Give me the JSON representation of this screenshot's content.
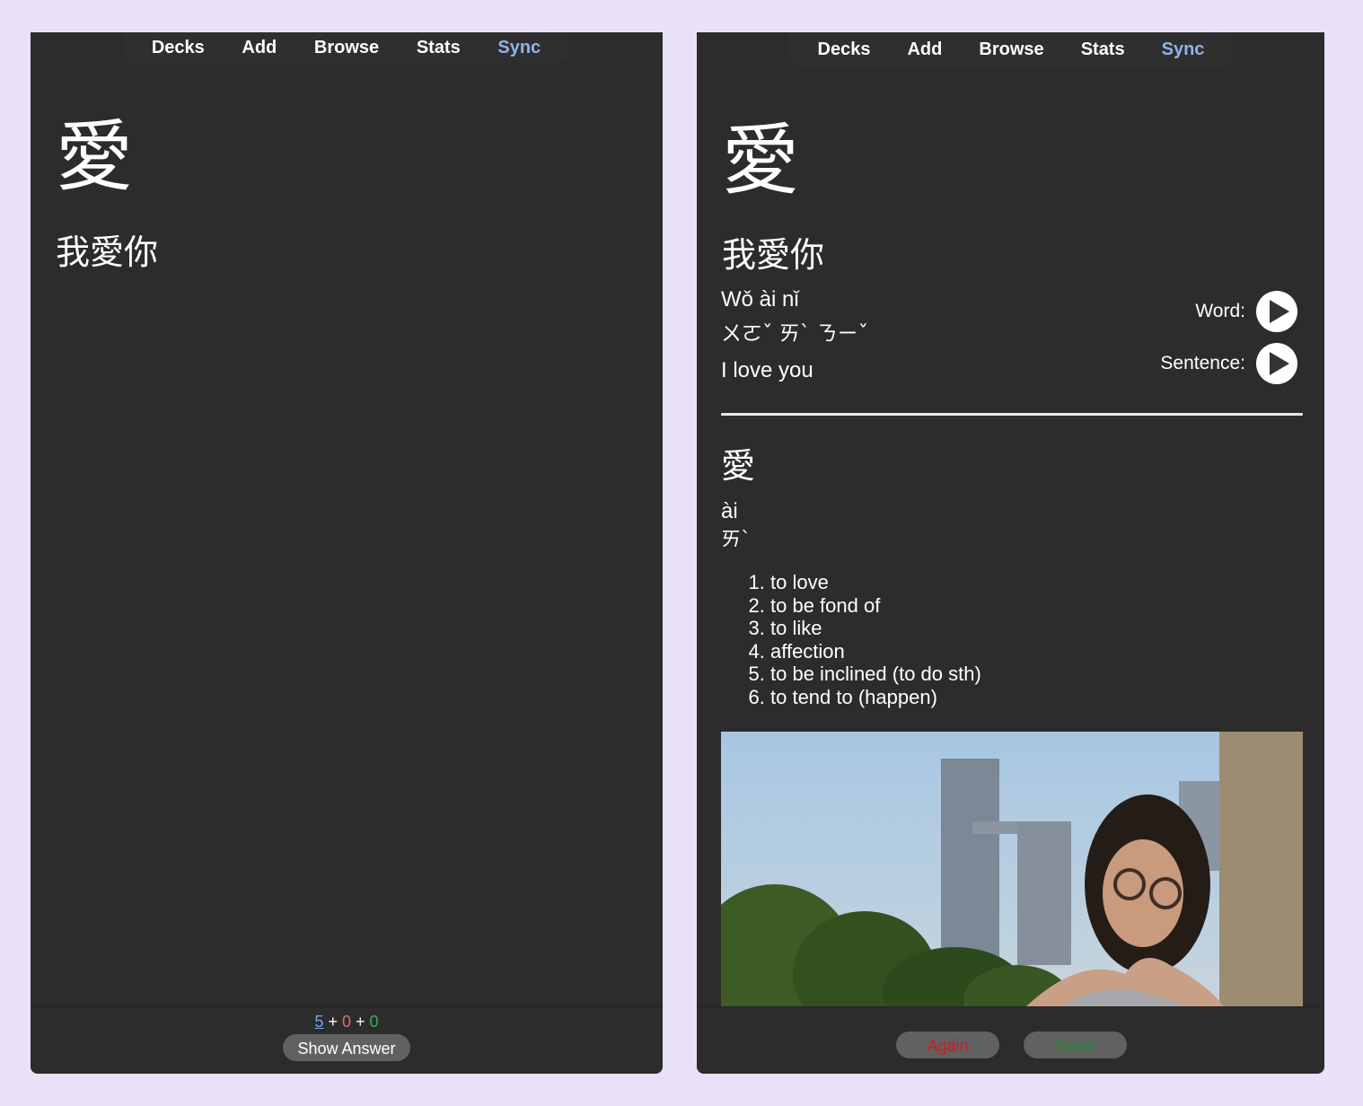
{
  "nav": {
    "items": [
      {
        "label": "Decks"
      },
      {
        "label": "Add"
      },
      {
        "label": "Browse"
      },
      {
        "label": "Stats"
      },
      {
        "label": "Sync"
      }
    ],
    "sync_color": "#8fb4ea"
  },
  "front": {
    "word": "愛",
    "sentence": "我愛你",
    "counts": {
      "new": "5",
      "plus1": "+",
      "learning": "0",
      "plus2": "+",
      "review": "0"
    },
    "show_answer_label": "Show Answer"
  },
  "back": {
    "word": "愛",
    "sentence": "我愛你",
    "pinyin": "Wǒ ài nǐ",
    "zhuyin": "ㄨㄛˇ ㄞˋ ㄋㄧˇ",
    "translation": "I love you",
    "audio": {
      "word_label": "Word:",
      "sentence_label": "Sentence:"
    },
    "dictionary": {
      "character": "愛",
      "pinyin": "ài",
      "zhuyin": "ㄞˋ",
      "definitions": [
        "to love",
        "to be fond of",
        "to like",
        "affection",
        "to be inclined (to do sth)",
        "to tend to (happen)"
      ]
    },
    "image_alt": "Woman making heart shape with hands in front of skyscrapers",
    "buttons": {
      "again": "Again",
      "good": "Good"
    },
    "colors": {
      "again": "#d01b1b",
      "good": "#1e8a2e"
    }
  }
}
